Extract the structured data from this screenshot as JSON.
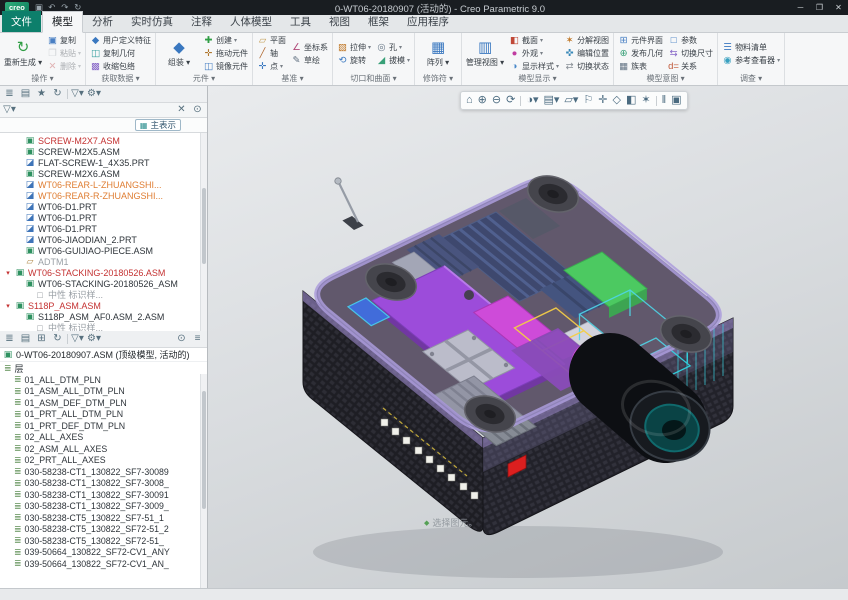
{
  "window": {
    "brand": "creo",
    "title": "0-WT06-20180907 (活动的) - Creo Parametric 9.0",
    "quick_icons": [
      {
        "name": "save-icon",
        "glyph": "▣"
      },
      {
        "name": "undo-icon",
        "glyph": "↶"
      },
      {
        "name": "redo-icon",
        "glyph": "↷"
      },
      {
        "name": "regenerate-icon",
        "glyph": "↻"
      }
    ],
    "controls": [
      {
        "name": "minimize-button",
        "glyph": "─"
      },
      {
        "name": "maximize-button",
        "glyph": "❐"
      },
      {
        "name": "close-button",
        "glyph": "✕"
      }
    ]
  },
  "tabs": [
    {
      "label": "文件",
      "kind": "file"
    },
    {
      "label": "模型",
      "kind": "active"
    },
    {
      "label": "分析"
    },
    {
      "label": "实时仿真"
    },
    {
      "label": "注释"
    },
    {
      "label": "人体模型"
    },
    {
      "label": "工具"
    },
    {
      "label": "视图"
    },
    {
      "label": "框架"
    },
    {
      "label": "应用程序"
    }
  ],
  "ribbon": {
    "groups": [
      {
        "label": "操作",
        "items": [
          {
            "kind": "big",
            "label": "重新生成",
            "icon": "↻",
            "color": "#2f9e44",
            "dd": true
          },
          {
            "kind": "col",
            "buttons": [
              {
                "label": "复制",
                "icon": "▣",
                "color": "#4a80c4"
              },
              {
                "label": "粘贴",
                "icon": "❐",
                "color": "#98a0a8",
                "dd": true,
                "disabled": true
              },
              {
                "label": "删除",
                "icon": "✕",
                "color": "#c05050",
                "dd": true,
                "disabled": true
              }
            ]
          }
        ]
      },
      {
        "label": "获取数据",
        "items": [
          {
            "kind": "col",
            "buttons": [
              {
                "label": "用户定义特征",
                "icon": "◆",
                "color": "#3a78c0"
              },
              {
                "label": "复制几何",
                "icon": "◫",
                "color": "#38a0a0"
              },
              {
                "label": "收缩包络",
                "icon": "▩",
                "color": "#8868c8"
              }
            ]
          }
        ]
      },
      {
        "label": "元件",
        "items": [
          {
            "kind": "big",
            "label": "组装",
            "icon": "◆",
            "color": "#3a78c0",
            "dd": true
          },
          {
            "kind": "col",
            "buttons": [
              {
                "label": "创建",
                "icon": "✚",
                "color": "#2f9e44",
                "dd": true
              },
              {
                "label": "拖动元件",
                "icon": "✛",
                "color": "#b07830"
              },
              {
                "label": "镜像元件",
                "icon": "◫",
                "color": "#4a80c4"
              }
            ]
          }
        ]
      },
      {
        "label": "基准",
        "items": [
          {
            "kind": "col",
            "buttons": [
              {
                "label": "平面",
                "icon": "▱",
                "color": "#c09648"
              },
              {
                "label": "轴",
                "icon": "╱",
                "color": "#b06830"
              },
              {
                "label": "点",
                "icon": "✛",
                "color": "#3a78c0",
                "dd": true
              }
            ]
          },
          {
            "kind": "col",
            "buttons": [
              {
                "label": "坐标系",
                "icon": "∠",
                "color": "#b04878"
              },
              {
                "label": "草绘",
                "icon": "✎",
                "color": "#607080"
              }
            ]
          }
        ]
      },
      {
        "label": "切口和曲面",
        "items": [
          {
            "kind": "col",
            "buttons": [
              {
                "label": "拉伸",
                "icon": "▧",
                "color": "#c07828",
                "dd": true
              },
              {
                "label": "旋转",
                "icon": "⟲",
                "color": "#3a78c0"
              }
            ]
          },
          {
            "kind": "col",
            "buttons": [
              {
                "label": "孔",
                "icon": "◎",
                "color": "#687888",
                "dd": true
              },
              {
                "label": "拔模",
                "icon": "◢",
                "color": "#38a078",
                "dd": true
              }
            ]
          }
        ]
      },
      {
        "label": "修饰符",
        "items": [
          {
            "kind": "big",
            "label": "阵列",
            "icon": "▦",
            "color": "#3a78c0",
            "dd": true
          }
        ]
      },
      {
        "label": "模型显示",
        "items": [
          {
            "kind": "big",
            "label": "管理视图",
            "icon": "▥",
            "color": "#3a78c0",
            "dd": true
          },
          {
            "kind": "col",
            "buttons": [
              {
                "label": "截面",
                "icon": "◧",
                "color": "#c04838",
                "dd": true
              },
              {
                "label": "外观",
                "icon": "●",
                "color": "#c03ca0",
                "dd": true
              },
              {
                "label": "显示样式",
                "icon": "◑",
                "color": "#4888c8",
                "dd": true
              }
            ]
          },
          {
            "kind": "col",
            "buttons": [
              {
                "label": "分解视图",
                "icon": "✶",
                "color": "#c07828"
              },
              {
                "label": "编辑位置",
                "icon": "✜",
                "color": "#3888b8"
              },
              {
                "label": "切换状态",
                "icon": "⇄",
                "color": "#888f96"
              }
            ]
          }
        ]
      },
      {
        "label": "模型意图",
        "items": [
          {
            "kind": "col",
            "buttons": [
              {
                "label": "元件界面",
                "icon": "⊞",
                "color": "#4a80c4"
              },
              {
                "label": "发布几何",
                "icon": "⊕",
                "color": "#38a078"
              },
              {
                "label": "族表",
                "icon": "▦",
                "color": "#687888"
              }
            ]
          },
          {
            "kind": "col",
            "buttons": [
              {
                "label": "参数",
                "icon": "□",
                "color": "#3a78c0"
              },
              {
                "label": "切换尺寸",
                "icon": "⇆",
                "color": "#8868c8"
              },
              {
                "label": "关系",
                "icon": "d=",
                "color": "#c05838"
              }
            ]
          }
        ]
      },
      {
        "label": "调查",
        "items": [
          {
            "kind": "col",
            "buttons": [
              {
                "label": "物料清单",
                "icon": "☰",
                "color": "#3a78c0"
              },
              {
                "label": "参考查看器",
                "icon": "◉",
                "color": "#38a0c0",
                "dd": true
              }
            ]
          }
        ]
      }
    ]
  },
  "left_panel": {
    "toolbar_top": [
      {
        "name": "model-tree-tab-icon",
        "glyph": "≣"
      },
      {
        "name": "folder-browser-icon",
        "glyph": "▤"
      },
      {
        "name": "favorites-icon",
        "glyph": "★"
      },
      {
        "name": "history-icon",
        "glyph": "↻"
      },
      {
        "sep": true
      },
      {
        "name": "show-menu-icon",
        "glyph": "▽",
        "dd": true
      },
      {
        "name": "settings-icon",
        "glyph": "⚙",
        "dd": true
      }
    ],
    "filter_row": [
      {
        "name": "filter-icon",
        "glyph": "▽",
        "dd": true
      },
      {
        "spacer": true
      },
      {
        "name": "close-icon",
        "glyph": "✕"
      },
      {
        "name": "search-icon",
        "glyph": "⊙"
      }
    ],
    "rep_chip": {
      "icon": "▦",
      "label": "主表示"
    },
    "model_tree": [
      {
        "label": "SCREW-M2X7.ASM",
        "type": "asm",
        "color": "red",
        "indent": 1
      },
      {
        "label": "SCREW-M2X5.ASM",
        "type": "asm",
        "indent": 1
      },
      {
        "label": "FLAT-SCREW-1_4X35.PRT",
        "type": "prt",
        "indent": 1
      },
      {
        "label": "SCREW-M2X6.ASM",
        "type": "asm",
        "indent": 1
      },
      {
        "label": "WT06-REAR-L-ZHUANGSHI...",
        "type": "prt",
        "color": "orange",
        "indent": 1
      },
      {
        "label": "WT06-REAR-R-ZHUANGSHI...",
        "type": "prt",
        "color": "orange",
        "indent": 1
      },
      {
        "label": "WT06-D1.PRT",
        "type": "prt",
        "indent": 1
      },
      {
        "label": "WT06-D1.PRT",
        "type": "prt",
        "indent": 1
      },
      {
        "label": "WT06-D1.PRT",
        "type": "prt",
        "indent": 1
      },
      {
        "label": "WT06-JIAODIAN_2.PRT",
        "type": "prt",
        "indent": 1
      },
      {
        "label": "WT06-GUIJIAO-PIECE.ASM",
        "type": "asm",
        "indent": 1
      },
      {
        "label": "ADTM1",
        "type": "datum",
        "color": "gray",
        "indent": 1
      },
      {
        "label": "WT06-STACKING-20180526.ASM",
        "type": "asm",
        "color": "red",
        "indent": 0,
        "expander": "▾"
      },
      {
        "label": "WT06-STACKING-20180526_ASM",
        "type": "asm",
        "indent": 1
      },
      {
        "label": "中性 标识样...",
        "type": "generic",
        "color": "gray",
        "indent": 2
      },
      {
        "label": "S118P_ASM.ASM",
        "type": "asm",
        "color": "red",
        "indent": 0,
        "expander": "▾"
      },
      {
        "label": "S118P_ASM_AF0.ASM_2.ASM",
        "type": "asm",
        "indent": 1
      },
      {
        "label": "中性 标识样...",
        "type": "generic",
        "color": "gray",
        "indent": 2
      }
    ],
    "toolbar_mid": [
      {
        "name": "layer-tree-icon",
        "glyph": "≣"
      },
      {
        "name": "views-icon",
        "glyph": "▤"
      },
      {
        "name": "add-layer-icon",
        "glyph": "⊞"
      },
      {
        "name": "refresh-icon",
        "glyph": "↻"
      },
      {
        "sep": true
      },
      {
        "name": "filter-icon",
        "glyph": "▽",
        "dd": true
      },
      {
        "name": "settings-icon",
        "glyph": "⚙",
        "dd": true
      },
      {
        "spacer": true
      },
      {
        "name": "search-icon",
        "glyph": "⊙"
      },
      {
        "name": "menu-icon",
        "glyph": "≡"
      }
    ],
    "layer_panel": {
      "model_line": "0-WT06-20180907.ASM (顶级模型, 活动的)",
      "section_label": "层",
      "layers": [
        "01_ALL_DTM_PLN",
        "01_ASM_ALL_DTM_PLN",
        "01_ASM_DEF_DTM_PLN",
        "01_PRT_ALL_DTM_PLN",
        "01_PRT_DEF_DTM_PLN",
        "02_ALL_AXES",
        "02_ASM_ALL_AXES",
        "02_PRT_ALL_AXES",
        "030-58238-CT1_130822_SF7-30089",
        "030-58238-CT1_130822_SF7-3008_",
        "030-58238-CT1_130822_SF7-30091",
        "030-58238-CT1_130822_SF7-3009_",
        "030-58238-CT5_130822_SF7-51_1",
        "030-58238-CT5_130822_SF72-51_2",
        "030-58238-CT5_130822_SF72-51_",
        "039-50664_130822_SF72-CV1_ANY",
        "039-50664_130822_SF72-CV1_AN_"
      ]
    }
  },
  "graphics": {
    "message": "选择图元。",
    "toolbar": [
      {
        "name": "refit-icon",
        "glyph": "⌂"
      },
      {
        "name": "zoom-in-icon",
        "glyph": "⊕"
      },
      {
        "name": "zoom-out-icon",
        "glyph": "⊖"
      },
      {
        "name": "repaint-icon",
        "glyph": "⟳"
      },
      {
        "sep": true
      },
      {
        "name": "display-style-icon",
        "glyph": "◑",
        "dd": true
      },
      {
        "name": "saved-orientations-icon",
        "glyph": "▤",
        "dd": true
      },
      {
        "name": "datum-display-icon",
        "glyph": "▱",
        "dd": true
      },
      {
        "name": "annotation-display-icon",
        "glyph": "⚐"
      },
      {
        "name": "spin-center-icon",
        "glyph": "✛"
      },
      {
        "name": "perspective-icon",
        "glyph": "◇"
      },
      {
        "name": "section-icon",
        "glyph": "◧"
      },
      {
        "name": "explode-icon",
        "glyph": "✶"
      },
      {
        "sep": true
      },
      {
        "name": "pause-icon",
        "glyph": "‖"
      },
      {
        "name": "select-box-icon",
        "glyph": "▣"
      }
    ]
  },
  "colors": {
    "accent_teal": "#0d7f6b",
    "titlebar": "#191d21",
    "tree_red": "#c43232",
    "tree_orange": "#df7d32",
    "model_purple": "#9130d8",
    "model_magenta": "#d02fd6",
    "model_green": "#2ecc40",
    "model_cyan": "#30dce8",
    "model_yellow": "#ffd21f",
    "lens_teal": "#0a4345"
  }
}
